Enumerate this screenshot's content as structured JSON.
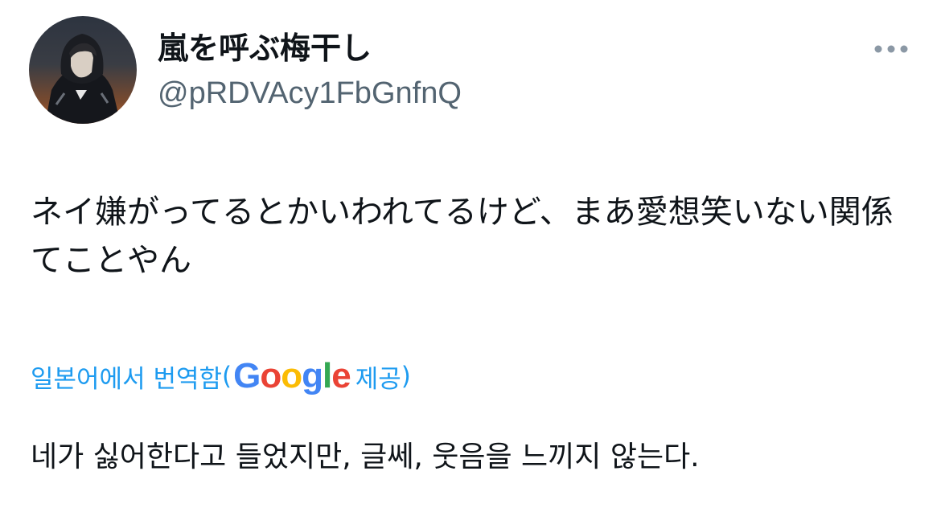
{
  "user": {
    "display_name": "嵐を呼ぶ梅干し",
    "handle": "@pRDVAcy1FbGnfnQ",
    "avatar_icon": "avatar-photo-hooded-person"
  },
  "menu": {
    "icon": "more-horizontal-icon"
  },
  "tweet": {
    "text": "ネイ嫌がってるとかいわれてるけど、まあ愛想笑いない関係てことやん"
  },
  "translation": {
    "label": "일본어에서 번역함",
    "paren_open": "(",
    "provider_letters": [
      "G",
      "o",
      "o",
      "g",
      "l",
      "e"
    ],
    "provider_colors": [
      "#4285f4",
      "#ea4335",
      "#fbbc05",
      "#4285f4",
      "#34a853",
      "#ea4335"
    ],
    "provided_by": "제공",
    "paren_close": ")",
    "text": "네가 싫어한다고 들었지만, 글쎄, 웃음을 느끼지 않는다."
  },
  "colors": {
    "primary_text": "#0f1419",
    "secondary_text": "#536471",
    "link": "#1d9bf0"
  }
}
